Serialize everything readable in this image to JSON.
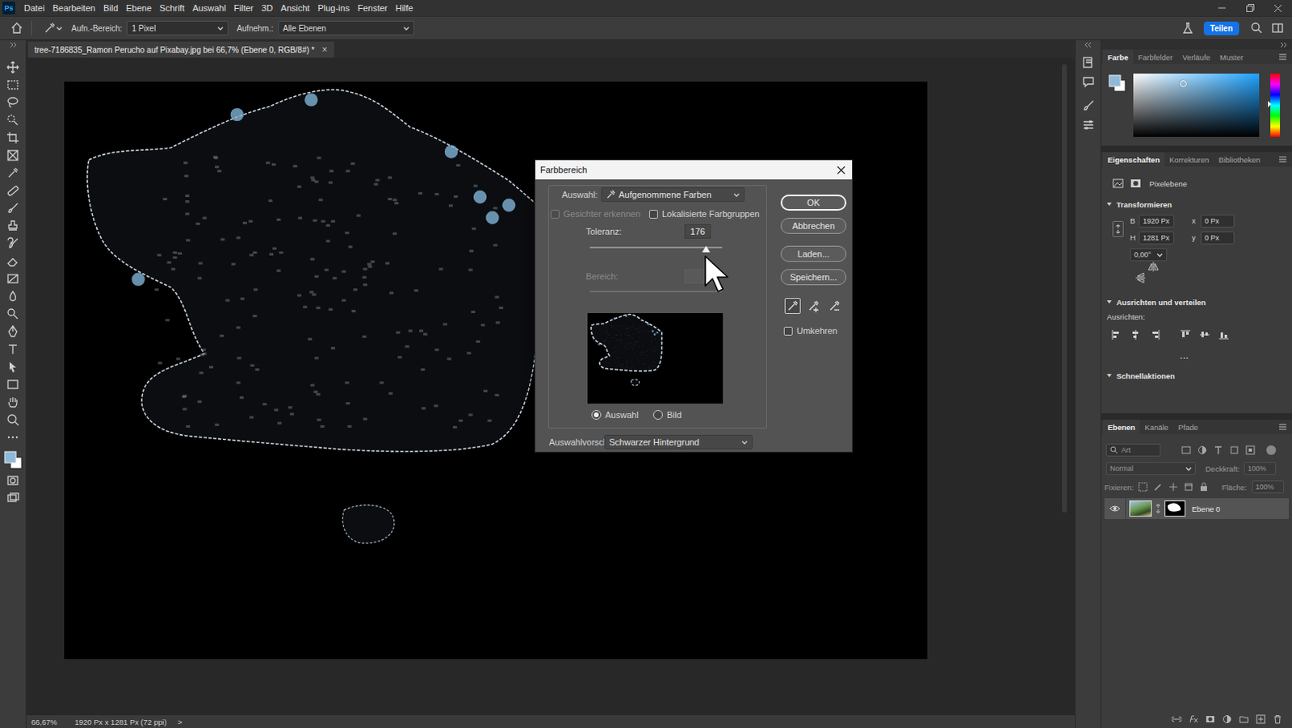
{
  "app": {
    "logo": "Ps"
  },
  "menu": [
    "Datei",
    "Bearbeiten",
    "Bild",
    "Ebene",
    "Schrift",
    "Auswahl",
    "Filter",
    "3D",
    "Ansicht",
    "Plug-ins",
    "Fenster",
    "Hilfe"
  ],
  "options_bar": {
    "sample_size_label": "Aufn.-Bereich:",
    "sample_size": "1 Pixel",
    "sample_label": "Aufnehm.:",
    "sample": "Alle Ebenen",
    "share": "Teilen"
  },
  "document_tab": {
    "title": "tree-7186835_Ramon Perucho auf Pixabay.jpg bei 66,7% (Ebene 0, RGB/8#) *",
    "close": "×"
  },
  "dialog": {
    "title": "Farbbereich",
    "select_label": "Auswahl:",
    "select_value": "Aufgenommene Farben",
    "checkboxes": [
      {
        "label": "Gesichter erkennen",
        "checked": false,
        "disabled": true
      },
      {
        "label": "Lokalisierte Farbgruppen",
        "checked": false,
        "disabled": false
      }
    ],
    "tolerance": {
      "label": "Toleranz:",
      "value": "176",
      "level": 0.88
    },
    "range": {
      "label": "Bereich:",
      "disabled": true
    },
    "preview_modes": [
      {
        "label": "Auswahl",
        "selected": true
      },
      {
        "label": "Bild",
        "selected": false
      }
    ],
    "preview_label": "Auswahlvorschau:",
    "preview_value": "Schwarzer Hintergrund",
    "buttons": [
      {
        "label": "OK",
        "default": true
      },
      {
        "label": "Abbrechen",
        "default": false
      },
      {
        "label": "Laden...",
        "default": false
      },
      {
        "label": "Speichern...",
        "default": false
      }
    ],
    "eyedroppers": [
      {
        "kind": "sample",
        "selected": true
      },
      {
        "kind": "add",
        "selected": false
      },
      {
        "kind": "subtract",
        "selected": false
      }
    ],
    "invert": {
      "label": "Umkehren",
      "checked": false
    }
  },
  "color_panel": {
    "tabs": [
      {
        "label": "Farbe",
        "selected": true
      },
      {
        "label": "Farbfelder",
        "selected": false
      },
      {
        "label": "Verläufe",
        "selected": false
      },
      {
        "label": "Muster",
        "selected": false
      }
    ]
  },
  "properties_panel": {
    "tabs": [
      {
        "label": "Eigenschaften",
        "selected": true
      },
      {
        "label": "Korrekturen",
        "selected": false
      },
      {
        "label": "Bibliotheken",
        "selected": false
      }
    ],
    "layer_type": "Pixelebene",
    "transform": {
      "title": "Transformieren",
      "expanded": true,
      "w_label": "B",
      "w": "1920 Px",
      "h_label": "H",
      "h": "1281 Px",
      "x_label": "x",
      "x": "0 Px",
      "y_label": "y",
      "y": "0 Px",
      "angle": "0,00°"
    },
    "align": {
      "title": "Ausrichten und verteilen",
      "expanded": true,
      "label": "Ausrichten:",
      "more": "..."
    },
    "quick_actions": {
      "title": "Schnellaktionen",
      "expanded": true
    }
  },
  "layers_panel": {
    "tabs": [
      {
        "label": "Ebenen",
        "selected": true
      },
      {
        "label": "Kanäle",
        "selected": false
      },
      {
        "label": "Pfade",
        "selected": false
      }
    ],
    "search_placeholder": "Art",
    "blend_mode": "Normal",
    "opacity_label": "Deckkraft:",
    "opacity": "100%",
    "lock_label": "Fixieren:",
    "fill_label": "Fläche:",
    "fill": "100%",
    "layers": [
      {
        "name": "Ebene 0",
        "visible": true,
        "selected": true
      }
    ]
  },
  "status_bar": {
    "zoom": "66,67%",
    "info": "1920 Px x 1281 Px (72 ppi)",
    "arrow": ">"
  }
}
